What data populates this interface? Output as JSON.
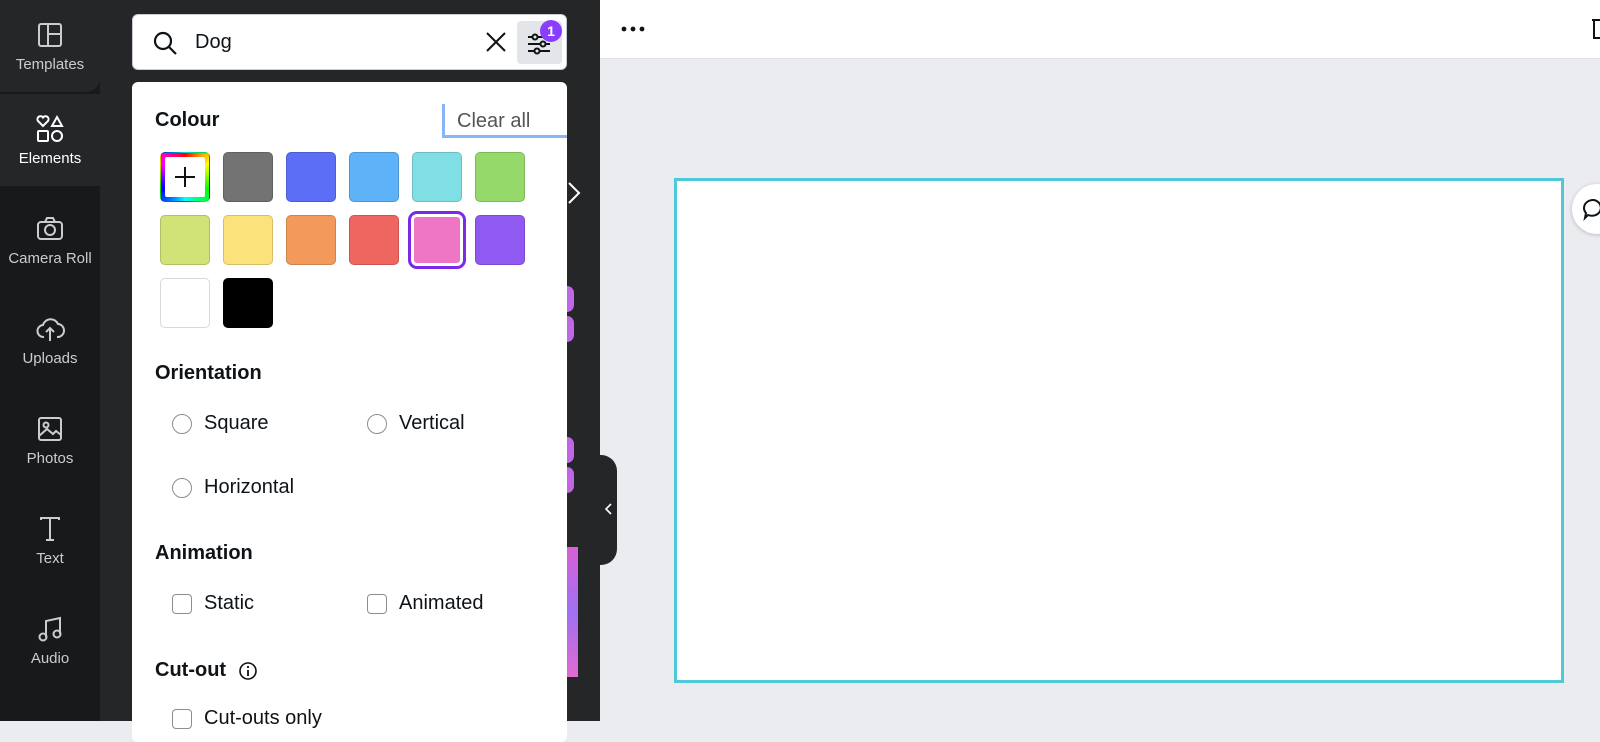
{
  "rail": {
    "items": [
      {
        "label": "Templates"
      },
      {
        "label": "Elements"
      },
      {
        "label": "Camera Roll"
      },
      {
        "label": "Uploads"
      },
      {
        "label": "Photos"
      },
      {
        "label": "Text"
      },
      {
        "label": "Audio"
      }
    ]
  },
  "search": {
    "value": "Dog",
    "filter_count": "1"
  },
  "filters": {
    "colour": {
      "title": "Colour",
      "clear_all": "Clear all",
      "swatches": [
        "#737373",
        "#5b6ef5",
        "#5db2f8",
        "#80dfe4",
        "#94d969",
        "#d1e277",
        "#fbe27a",
        "#f3995c",
        "#ef6560",
        "#ef76c5",
        "#8f59f2",
        "#ffffff",
        "#000000"
      ],
      "selected": "#ef76c5"
    },
    "orientation": {
      "title": "Orientation",
      "options": [
        "Square",
        "Vertical",
        "Horizontal"
      ]
    },
    "animation": {
      "title": "Animation",
      "options": [
        "Static",
        "Animated"
      ]
    },
    "cutout": {
      "title": "Cut-out",
      "option": "Cut-outs only"
    }
  },
  "colors": {
    "accent": "#8b3dff",
    "canvas_outline": "#4fc8d8"
  }
}
